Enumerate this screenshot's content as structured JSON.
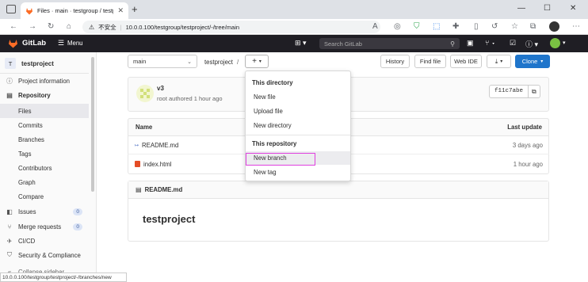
{
  "browser": {
    "tab_title": "Files · main · testgroup / testproj",
    "insecure_label": "不安全",
    "url": "10.0.0.100/testgroup/testproject/-/tree/main",
    "status_url": "10.0.0.100/testgroup/testproject/-/branches/new"
  },
  "header": {
    "brand": "GitLab",
    "menu_label": "Menu",
    "search_placeholder": "Search GitLab"
  },
  "sidebar": {
    "project_avatar": "T",
    "project_name": "testproject",
    "items": [
      {
        "label": "Project information",
        "icon": "info"
      },
      {
        "label": "Repository",
        "icon": "book"
      },
      {
        "label": "Files"
      },
      {
        "label": "Commits"
      },
      {
        "label": "Branches"
      },
      {
        "label": "Tags"
      },
      {
        "label": "Contributors"
      },
      {
        "label": "Graph"
      },
      {
        "label": "Compare"
      },
      {
        "label": "Issues",
        "badge": "0"
      },
      {
        "label": "Merge requests",
        "badge": "0"
      },
      {
        "label": "CI/CD"
      },
      {
        "label": "Security & Compliance"
      },
      {
        "label": "Collapse sidebar"
      }
    ]
  },
  "toolbar": {
    "branch": "main",
    "path": "testproject",
    "path_sep": "/",
    "plus": "+",
    "history": "History",
    "find_file": "Find file",
    "web_ide": "Web IDE",
    "clone": "Clone"
  },
  "commit": {
    "title": "v3",
    "meta": "root authored 1 hour ago",
    "sha": "f11c7abe"
  },
  "table": {
    "col_name": "Name",
    "col_update": "Last update",
    "rows": [
      {
        "name": "README.md",
        "updated": "3 days ago"
      },
      {
        "name": "index.html",
        "updated": "1 hour ago"
      }
    ]
  },
  "readme": {
    "file": "README.md",
    "heading": "testproject"
  },
  "dropdown": {
    "dir_header": "This directory",
    "new_file": "New file",
    "upload_file": "Upload file",
    "new_directory": "New directory",
    "repo_header": "This repository",
    "new_branch": "New branch",
    "new_tag": "New tag"
  },
  "colors": {
    "highlight": "#e040e0",
    "header_bg": "#1f1e24",
    "clone_btn": "#1f75cb",
    "gitlab_orange": "#fc6d26"
  }
}
